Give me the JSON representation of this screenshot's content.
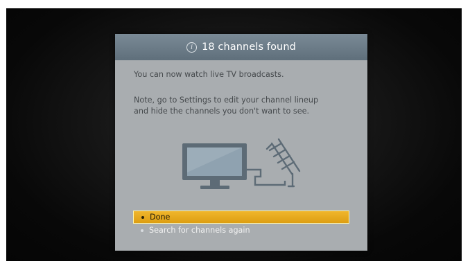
{
  "dialog": {
    "title": "18 channels found",
    "message_1": "You can now watch live TV broadcasts.",
    "message_2_line_1": "Note, go to Settings to edit your channel lineup",
    "message_2_line_2": "and hide the channels you don't want to see.",
    "info_icon_glyph": "i",
    "options": [
      {
        "label": "Done",
        "selected": true
      },
      {
        "label": "Search for channels again",
        "selected": false
      }
    ]
  },
  "colors": {
    "header": "#6b7b87",
    "panel": "#a9adb0",
    "selection": "#e8aa1e"
  },
  "icons": {
    "info": "info-circle-icon",
    "illustration": "tv-with-antenna-illustration"
  }
}
